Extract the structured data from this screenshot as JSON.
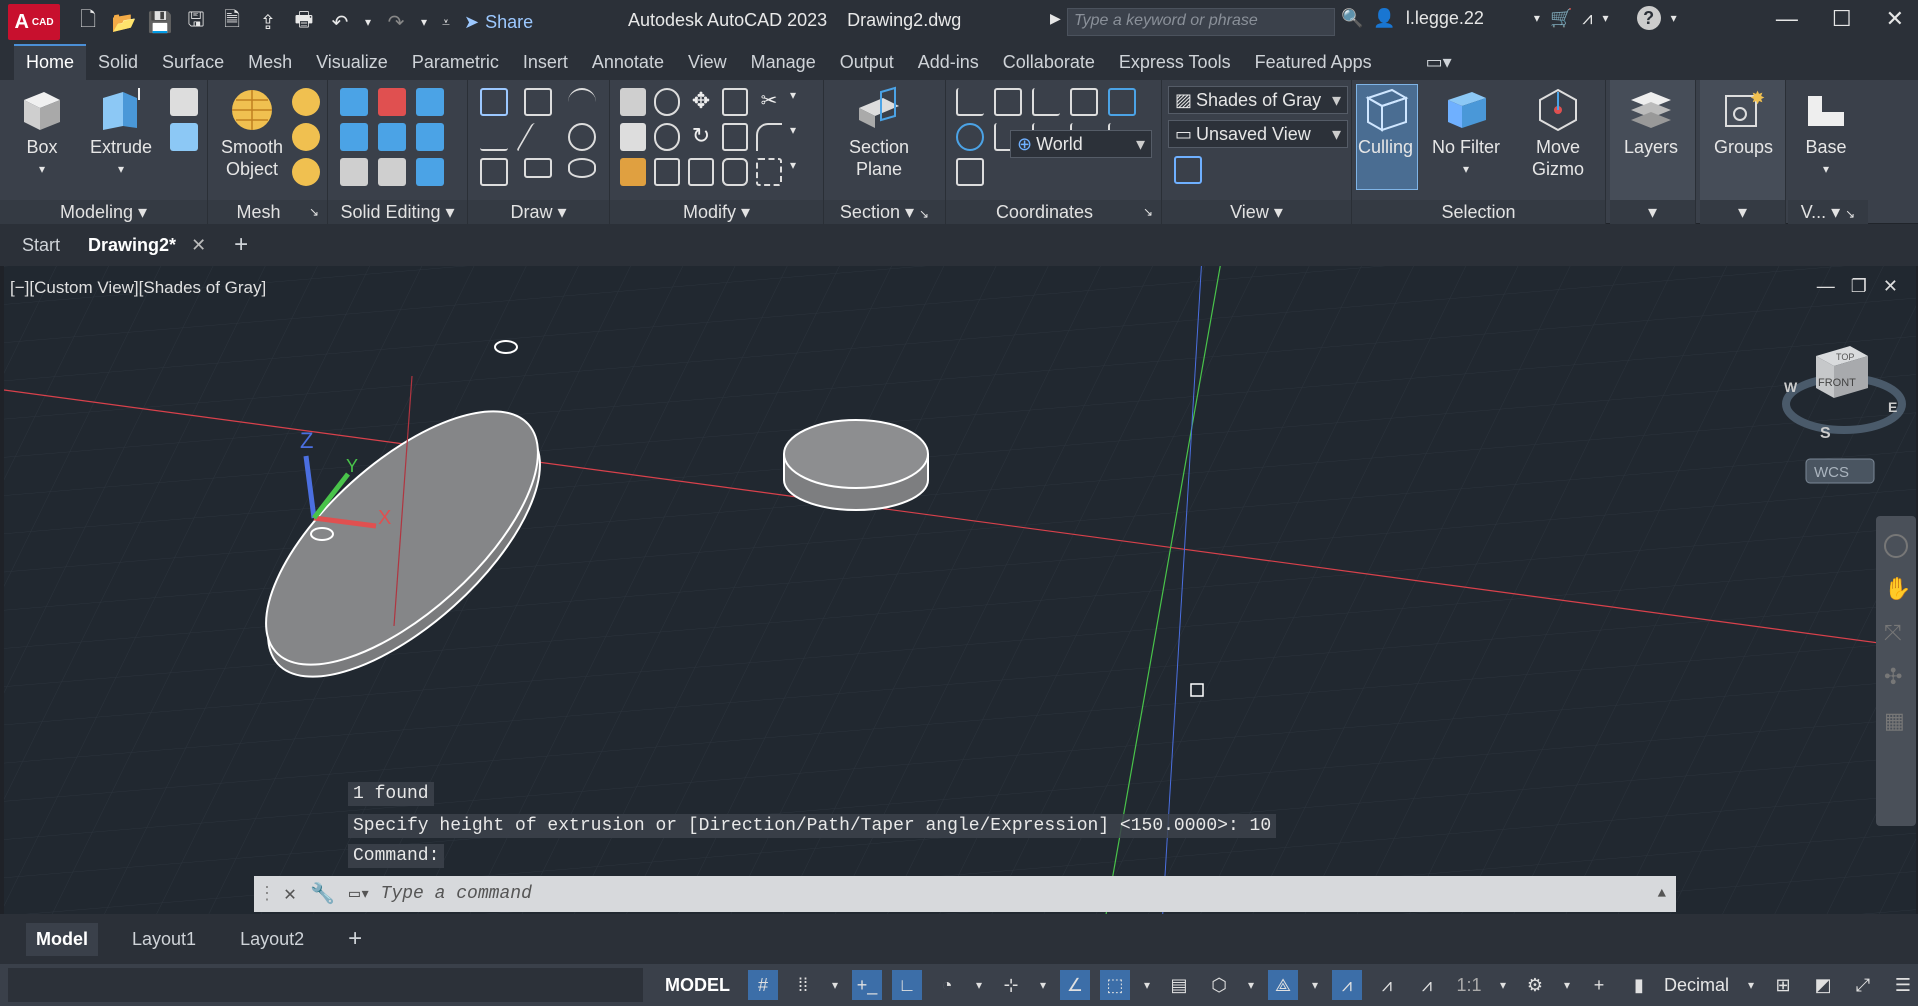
{
  "titlebar": {
    "logo": "A",
    "logo_sub": "CAD",
    "share": "Share",
    "app_title": "Autodesk AutoCAD 2023",
    "doc_title": "Drawing2.dwg",
    "search_placeholder": "Type a keyword or phrase",
    "user": "l.legge.22"
  },
  "ribbon_tabs": [
    "Home",
    "Solid",
    "Surface",
    "Mesh",
    "Visualize",
    "Parametric",
    "Insert",
    "Annotate",
    "View",
    "Manage",
    "Output",
    "Add-ins",
    "Collaborate",
    "Express Tools",
    "Featured Apps"
  ],
  "ribbon": {
    "box": "Box",
    "extrude": "Extrude",
    "smooth_object": "Smooth Object",
    "section_plane": "Section Plane",
    "visual_style": "Shades of Gray",
    "saved_view": "Unsaved View",
    "ucs": "World",
    "culling": "Culling",
    "no_filter": "No Filter",
    "move_gizmo": "Move Gizmo",
    "layers": "Layers",
    "groups": "Groups",
    "base": "Base",
    "panels": {
      "modeling": "Modeling",
      "mesh": "Mesh",
      "solid_editing": "Solid Editing",
      "draw": "Draw",
      "modify": "Modify",
      "section": "Section",
      "coordinates": "Coordinates",
      "view": "View",
      "selection": "Selection",
      "v": "V..."
    }
  },
  "doc_tabs": {
    "start": "Start",
    "drawing": "Drawing2*"
  },
  "viewport": {
    "label": "[−][Custom View][Shades of Gray]",
    "cube_top": "TOP",
    "cube_front": "FRONT",
    "compass_w": "W",
    "compass_e": "E",
    "compass_s": "S",
    "wcs": "WCS",
    "ucs_z": "Z",
    "ucs_y": "Y",
    "ucs_x": "X"
  },
  "command": {
    "history": [
      "1 found",
      "Specify height of extrusion or [Direction/Path/Taper angle/Expression] <150.0000>: 10",
      "Command:"
    ],
    "placeholder": "Type a command"
  },
  "layout_tabs": [
    "Model",
    "Layout1",
    "Layout2"
  ],
  "statusbar": {
    "model": "MODEL",
    "scale": "1:1",
    "units": "Decimal"
  },
  "colors": {
    "accent": "#4b8fd6",
    "x_axis": "#d9414b",
    "y_axis": "#49c34a",
    "z_axis": "#4b6fe0"
  }
}
